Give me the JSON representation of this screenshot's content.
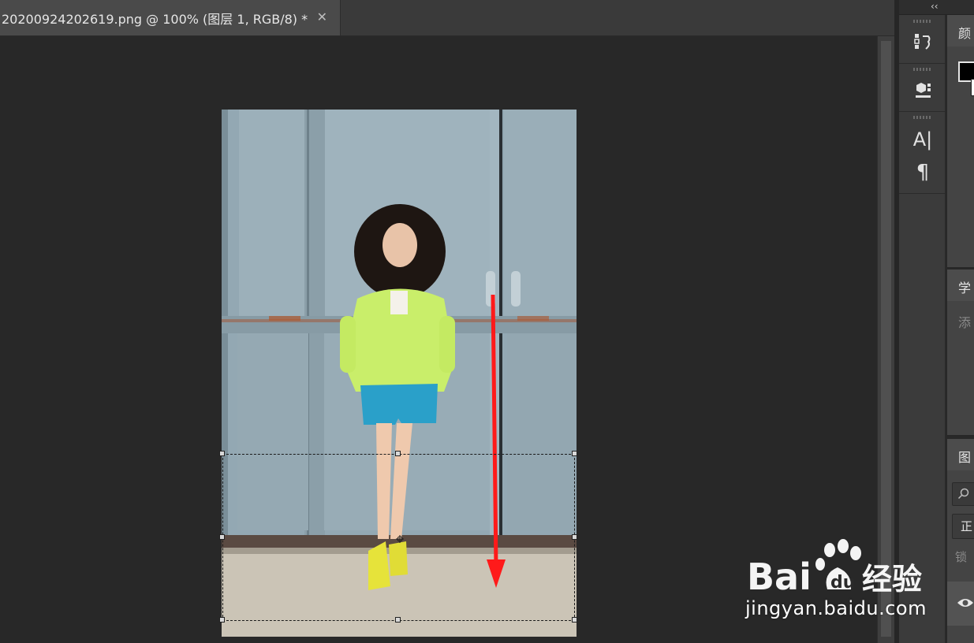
{
  "document_tab": {
    "title": "20200924202619.png @ 100% (图层 1, RGB/8) *",
    "close_glyph": "✕"
  },
  "panels_toggle": {
    "glyph": "‹‹"
  },
  "icon_strip": {
    "items": [
      {
        "name": "history-icon"
      },
      {
        "name": "3d-icon"
      },
      {
        "name": "character-icon",
        "glyph": "A|"
      },
      {
        "name": "paragraph-icon",
        "glyph": "¶"
      }
    ]
  },
  "color_panel": {
    "tab_label": "颜",
    "foreground_color": "#000000"
  },
  "learn_panel": {
    "tab_label": "学",
    "dim_text": "添"
  },
  "layers_panel": {
    "tab_label": "图",
    "blend_mode_text": "正",
    "lock_text": "锁"
  },
  "watermark": {
    "logo_text": "Bai",
    "logo_suffix": "经验",
    "url": "jingyan.baidu.com"
  }
}
